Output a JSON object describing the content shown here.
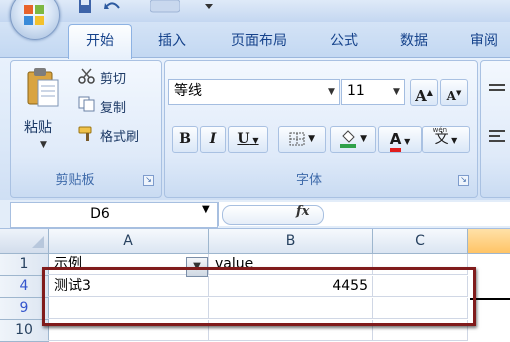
{
  "app": {
    "accent": "#15428b",
    "selected_header_color": "#ffc466",
    "highlight_box_color": "#801b1b"
  },
  "tabs": [
    "开始",
    "插入",
    "页面布局",
    "公式",
    "数据",
    "审阅"
  ],
  "clipboard": {
    "paste_label": "粘贴",
    "cut_label": "剪切",
    "copy_label": "复制",
    "format_painter_label": "格式刷",
    "group_label": "剪贴板"
  },
  "font_group": {
    "font_name": "等线",
    "font_size": "11",
    "bold": "B",
    "italic": "I",
    "underline": "U",
    "grow_font": "A",
    "shrink_font": "A",
    "font_color_label": "A",
    "phonetic_label": "wén",
    "phonetic_char": "文",
    "group_label": "字体"
  },
  "formula_bar": {
    "name_box": "D6",
    "fx_label": "fx",
    "formula": ""
  },
  "columns": [
    "A",
    "B",
    "C"
  ],
  "rows": [
    {
      "num": "1",
      "a": "示例",
      "b": "value",
      "c": "",
      "link": false
    },
    {
      "num": "4",
      "a": "测试3",
      "b": "4455",
      "c": "",
      "link": true
    },
    {
      "num": "9",
      "a": "",
      "b": "",
      "c": "",
      "link": true
    },
    {
      "num": "10",
      "a": "",
      "b": "",
      "c": "",
      "link": false
    }
  ]
}
